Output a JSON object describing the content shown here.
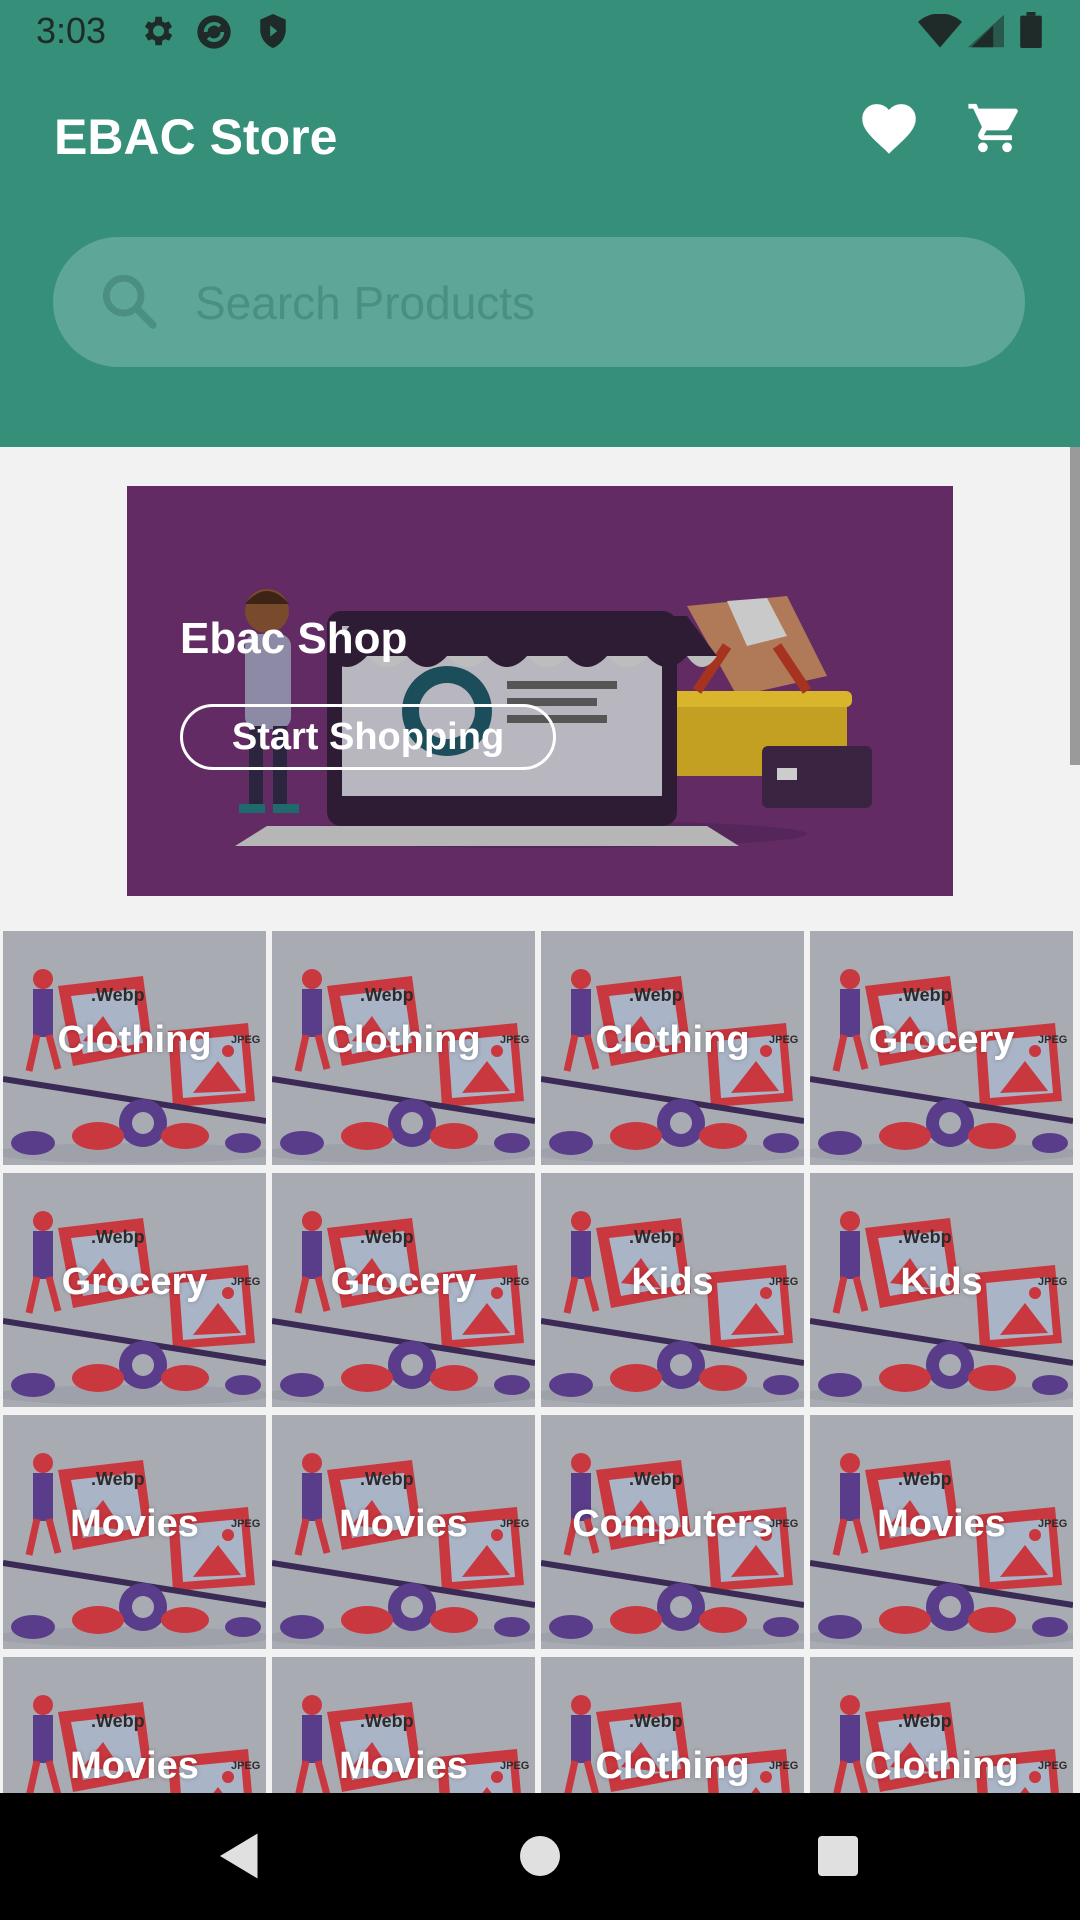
{
  "status_bar": {
    "time": "3:03",
    "left_icons": [
      "gear-icon",
      "sync-icon",
      "shield-icon"
    ],
    "right_icons": [
      "wifi-icon",
      "signal-icon",
      "battery-icon"
    ]
  },
  "app_bar": {
    "title": "EBAC Store",
    "actions": [
      "heart-icon",
      "cart-icon"
    ]
  },
  "search": {
    "placeholder": "Search Products"
  },
  "banner": {
    "title": "Ebac Shop",
    "button_label": "Start Shopping",
    "background": "#632b64"
  },
  "categories": [
    "Clothing",
    "Clothing",
    "Clothing",
    "Grocery",
    "Grocery",
    "Grocery",
    "Kids",
    "Kids",
    "Movies",
    "Movies",
    "Computers",
    "Movies",
    "Movies",
    "Movies",
    "Clothing",
    "Clothing"
  ],
  "tile_image_labels": [
    ".Webp",
    "JPEG"
  ],
  "colors": {
    "primary": "#368f79",
    "search_bg": "#5ea696",
    "banner_bg": "#632b64",
    "tile_bg": "#a8abb2"
  },
  "nav_bar": [
    "back-icon",
    "home-icon",
    "recents-icon"
  ]
}
